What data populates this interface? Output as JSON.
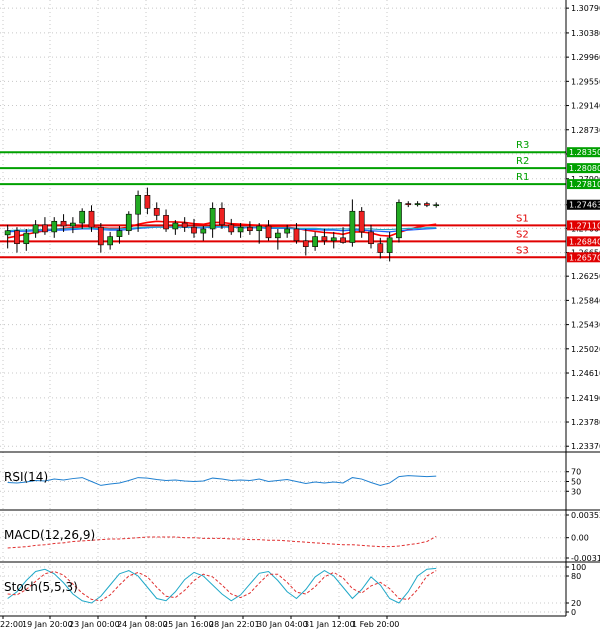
{
  "chart_data": [
    {
      "type": "candlestick",
      "title": "",
      "y_ticks": [
        1.3079,
        1.3037,
        1.2996,
        1.2955,
        1.2914,
        1.2873,
        1.2832,
        1.279,
        1.2746,
        1.2706,
        1.2665,
        1.2625,
        1.2584,
        1.2543,
        1.2502,
        1.2461,
        1.2419,
        1.2378,
        1.2337
      ],
      "y_tick_labels": [
        "1.30790",
        "1.30380",
        "1.29960",
        "1.29550",
        "1.29140",
        "1.28730",
        "1.28320",
        "1.27900",
        "1.27460",
        "1.27060",
        "1.26650",
        "1.26250",
        "1.25840",
        "1.25430",
        "1.25020",
        "1.24610",
        "1.24190",
        "1.23780",
        "1.23370"
      ],
      "ylim": [
        1.2334,
        1.3086
      ],
      "x_tick_labels": [
        "22:00",
        "19 Jan 20:00",
        "23 Jan 00:00",
        "24 Jan 08:00",
        "25 Jan 16:00",
        "28 Jan 22:01",
        "30 Jan 04:00",
        "31 Jan 12:00",
        "1 Feb 20:00"
      ],
      "levels": [
        {
          "name": "R3",
          "value": 1.2835,
          "label": "1.28350",
          "color": "#00a000"
        },
        {
          "name": "R2",
          "value": 1.2808,
          "label": "1.28080",
          "color": "#00a000"
        },
        {
          "name": "R1",
          "value": 1.2781,
          "label": "1.27810",
          "color": "#00a000"
        },
        {
          "name": "S1",
          "value": 1.2711,
          "label": "1.27110",
          "color": "#e00000"
        },
        {
          "name": "S2",
          "value": 1.2684,
          "label": "1.26840",
          "color": "#e00000"
        },
        {
          "name": "S3",
          "value": 1.2657,
          "label": "1.26570",
          "color": "#e00000"
        }
      ],
      "current_price": {
        "value": 1.2746,
        "label": "1.27463"
      },
      "candles": [
        {
          "o": 1.2695,
          "h": 1.2712,
          "l": 1.2672,
          "c": 1.2702
        },
        {
          "o": 1.2702,
          "h": 1.2708,
          "l": 1.2665,
          "c": 1.268
        },
        {
          "o": 1.268,
          "h": 1.2705,
          "l": 1.2668,
          "c": 1.2698
        },
        {
          "o": 1.2698,
          "h": 1.272,
          "l": 1.269,
          "c": 1.2712
        },
        {
          "o": 1.2712,
          "h": 1.2725,
          "l": 1.2695,
          "c": 1.27
        },
        {
          "o": 1.27,
          "h": 1.2725,
          "l": 1.269,
          "c": 1.2718
        },
        {
          "o": 1.2718,
          "h": 1.273,
          "l": 1.27,
          "c": 1.271
        },
        {
          "o": 1.271,
          "h": 1.2725,
          "l": 1.2698,
          "c": 1.2715
        },
        {
          "o": 1.2715,
          "h": 1.274,
          "l": 1.2705,
          "c": 1.2735
        },
        {
          "o": 1.2735,
          "h": 1.2745,
          "l": 1.27,
          "c": 1.2708
        },
        {
          "o": 1.2708,
          "h": 1.2715,
          "l": 1.2665,
          "c": 1.2678
        },
        {
          "o": 1.2678,
          "h": 1.27,
          "l": 1.267,
          "c": 1.2692
        },
        {
          "o": 1.2692,
          "h": 1.271,
          "l": 1.268,
          "c": 1.2702
        },
        {
          "o": 1.2702,
          "h": 1.2735,
          "l": 1.2695,
          "c": 1.273
        },
        {
          "o": 1.273,
          "h": 1.277,
          "l": 1.27,
          "c": 1.2762
        },
        {
          "o": 1.2762,
          "h": 1.2775,
          "l": 1.273,
          "c": 1.274
        },
        {
          "o": 1.274,
          "h": 1.275,
          "l": 1.272,
          "c": 1.2728
        },
        {
          "o": 1.2728,
          "h": 1.2738,
          "l": 1.27,
          "c": 1.2705
        },
        {
          "o": 1.2705,
          "h": 1.272,
          "l": 1.2695,
          "c": 1.2715
        },
        {
          "o": 1.2715,
          "h": 1.2725,
          "l": 1.27,
          "c": 1.2708
        },
        {
          "o": 1.2708,
          "h": 1.2722,
          "l": 1.269,
          "c": 1.2698
        },
        {
          "o": 1.2698,
          "h": 1.271,
          "l": 1.2685,
          "c": 1.2705
        },
        {
          "o": 1.2705,
          "h": 1.275,
          "l": 1.269,
          "c": 1.274
        },
        {
          "o": 1.274,
          "h": 1.275,
          "l": 1.2705,
          "c": 1.2712
        },
        {
          "o": 1.2712,
          "h": 1.2722,
          "l": 1.2695,
          "c": 1.27
        },
        {
          "o": 1.27,
          "h": 1.2715,
          "l": 1.269,
          "c": 1.2708
        },
        {
          "o": 1.2708,
          "h": 1.2718,
          "l": 1.2695,
          "c": 1.2702
        },
        {
          "o": 1.2702,
          "h": 1.2715,
          "l": 1.268,
          "c": 1.271
        },
        {
          "o": 1.271,
          "h": 1.272,
          "l": 1.2685,
          "c": 1.269
        },
        {
          "o": 1.269,
          "h": 1.2705,
          "l": 1.267,
          "c": 1.2698
        },
        {
          "o": 1.2698,
          "h": 1.2712,
          "l": 1.269,
          "c": 1.2705
        },
        {
          "o": 1.2705,
          "h": 1.2715,
          "l": 1.268,
          "c": 1.2685
        },
        {
          "o": 1.2685,
          "h": 1.2705,
          "l": 1.266,
          "c": 1.2675
        },
        {
          "o": 1.2675,
          "h": 1.27,
          "l": 1.2668,
          "c": 1.2692
        },
        {
          "o": 1.2692,
          "h": 1.2705,
          "l": 1.2678,
          "c": 1.2685
        },
        {
          "o": 1.2685,
          "h": 1.27,
          "l": 1.2672,
          "c": 1.269
        },
        {
          "o": 1.269,
          "h": 1.2708,
          "l": 1.268,
          "c": 1.2682
        },
        {
          "o": 1.2682,
          "h": 1.2755,
          "l": 1.2675,
          "c": 1.2735
        },
        {
          "o": 1.2735,
          "h": 1.2742,
          "l": 1.269,
          "c": 1.27
        },
        {
          "o": 1.27,
          "h": 1.2712,
          "l": 1.2672,
          "c": 1.268
        },
        {
          "o": 1.268,
          "h": 1.269,
          "l": 1.2655,
          "c": 1.2665
        },
        {
          "o": 1.2665,
          "h": 1.27,
          "l": 1.265,
          "c": 1.269
        },
        {
          "o": 1.269,
          "h": 1.2755,
          "l": 1.2682,
          "c": 1.275
        },
        {
          "o": 1.2748,
          "h": 1.2752,
          "l": 1.2742,
          "c": 1.2746
        },
        {
          "o": 1.2746,
          "h": 1.2752,
          "l": 1.2743,
          "c": 1.2748
        },
        {
          "o": 1.2748,
          "h": 1.2751,
          "l": 1.2742,
          "c": 1.2745
        },
        {
          "o": 1.2745,
          "h": 1.275,
          "l": 1.2741,
          "c": 1.2746
        }
      ],
      "series": [
        {
          "color": "#ff0000",
          "values": [
            1.269,
            1.2693,
            1.2696,
            1.2699,
            1.2702,
            1.2704,
            1.2706,
            1.2707,
            1.2709,
            1.2709,
            1.2707,
            1.2706,
            1.2706,
            1.2708,
            1.2713,
            1.2716,
            1.2718,
            1.2717,
            1.2717,
            1.2716,
            1.2714,
            1.2713,
            1.2716,
            1.2716,
            1.2714,
            1.2713,
            1.2712,
            1.2711,
            1.2709,
            1.2708,
            1.2708,
            1.2706,
            1.2703,
            1.2701,
            1.2699,
            1.2698,
            1.2696,
            1.27,
            1.27,
            1.2698,
            1.2694,
            1.2693,
            1.2699,
            1.2704,
            1.2708,
            1.2711,
            1.2713
          ]
        },
        {
          "color": "#2060ff",
          "values": [
            1.27,
            1.2701,
            1.2701,
            1.2702,
            1.2702,
            1.2703,
            1.2703,
            1.2704,
            1.2705,
            1.2705,
            1.2704,
            1.2703,
            1.2703,
            1.2704,
            1.2706,
            1.2707,
            1.2708,
            1.2708,
            1.2708,
            1.2708,
            1.2707,
            1.2707,
            1.2708,
            1.2708,
            1.2708,
            1.2707,
            1.2707,
            1.2707,
            1.2706,
            1.2706,
            1.2706,
            1.2705,
            1.2704,
            1.2704,
            1.2703,
            1.2703,
            1.2702,
            1.2703,
            1.2703,
            1.2702,
            1.2701,
            1.27,
            1.2702,
            1.2703,
            1.2704,
            1.2705,
            1.2706
          ]
        },
        {
          "color": "#20a8c8",
          "values": [
            1.2702,
            1.2703,
            1.2703,
            1.2704,
            1.2704,
            1.2705,
            1.2705,
            1.2706,
            1.2706,
            1.2706,
            1.2706,
            1.2705,
            1.2705,
            1.2706,
            1.2707,
            1.2708,
            1.2708,
            1.2708,
            1.2708,
            1.2708,
            1.2708,
            1.2708,
            1.2709,
            1.2709,
            1.2708,
            1.2708,
            1.2708,
            1.2708,
            1.2707,
            1.2707,
            1.2707,
            1.2706,
            1.2706,
            1.2706,
            1.2705,
            1.2705,
            1.2705,
            1.2705,
            1.2705,
            1.2705,
            1.2704,
            1.2704,
            1.2705,
            1.2706,
            1.2706,
            1.2707,
            1.2707
          ]
        }
      ]
    },
    {
      "type": "line",
      "title": "RSI(14)",
      "ylim": [
        0,
        100
      ],
      "y_tick_labels": [
        "70",
        "50",
        "30"
      ],
      "y_ticks": [
        70,
        50,
        30
      ],
      "series": [
        {
          "color": "#2080d0",
          "values": [
            48,
            47,
            49,
            52,
            51,
            55,
            53,
            56,
            58,
            50,
            42,
            45,
            47,
            52,
            58,
            57,
            54,
            52,
            53,
            51,
            50,
            51,
            57,
            55,
            52,
            53,
            52,
            55,
            50,
            52,
            54,
            50,
            46,
            49,
            47,
            49,
            47,
            58,
            55,
            48,
            42,
            47,
            60,
            62,
            61,
            60,
            61
          ]
        }
      ]
    },
    {
      "type": "line",
      "title": "MACD(12,26,9)",
      "ylim": [
        -0.003165,
        0.003537
      ],
      "y_tick_labels": [
        "0.003537",
        "0.00",
        "-0.003165"
      ],
      "y_ticks": [
        0.003537,
        0.0,
        -0.003165
      ],
      "series": [
        {
          "color": "#e03030",
          "values": [
            -0.0016,
            -0.0015,
            -0.0014,
            -0.0012,
            -0.0011,
            -0.0009,
            -0.0008,
            -0.0006,
            -0.0005,
            -0.0004,
            -0.0003,
            -0.0002,
            -0.0002,
            -0.0001,
            0.0,
            0.0001,
            0.0001,
            0.0001,
            0.0001,
            0.0,
            0.0,
            -0.0001,
            -0.0001,
            -0.0001,
            -0.0002,
            -0.0002,
            -0.0003,
            -0.0003,
            -0.0004,
            -0.0004,
            -0.0005,
            -0.0006,
            -0.0007,
            -0.0008,
            -0.0009,
            -0.001,
            -0.0011,
            -0.0011,
            -0.0012,
            -0.0013,
            -0.0014,
            -0.0014,
            -0.0013,
            -0.0011,
            -0.0009,
            -0.0006,
            0.0002
          ]
        }
      ]
    },
    {
      "type": "line",
      "title": "Stoch(5,5,3)",
      "ylim": [
        0,
        100
      ],
      "y_tick_labels": [
        "100",
        "80",
        "20",
        "0"
      ],
      "y_ticks": [
        100,
        80,
        20,
        0
      ],
      "series": [
        {
          "color": "#20a8c8",
          "values": [
            30,
            45,
            70,
            90,
            95,
            85,
            65,
            40,
            25,
            20,
            35,
            60,
            85,
            92,
            80,
            55,
            30,
            25,
            45,
            72,
            88,
            80,
            60,
            40,
            25,
            38,
            62,
            86,
            90,
            70,
            45,
            30,
            50,
            78,
            92,
            80,
            55,
            30,
            50,
            78,
            60,
            30,
            20,
            45,
            80,
            95,
            97
          ]
        },
        {
          "color": "#e03030",
          "values": [
            40,
            38,
            50,
            68,
            85,
            90,
            82,
            62,
            42,
            28,
            25,
            38,
            60,
            80,
            88,
            78,
            55,
            35,
            32,
            48,
            70,
            84,
            78,
            60,
            40,
            32,
            42,
            64,
            84,
            84,
            66,
            44,
            40,
            56,
            78,
            88,
            76,
            52,
            42,
            58,
            66,
            52,
            30,
            28,
            50,
            80,
            92
          ]
        }
      ]
    }
  ]
}
